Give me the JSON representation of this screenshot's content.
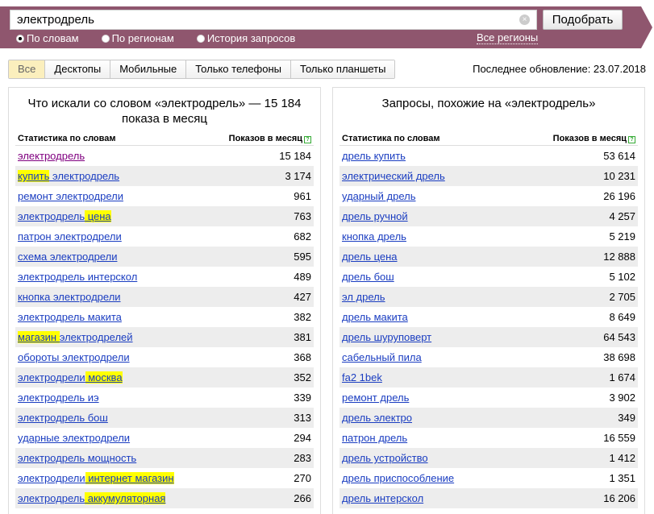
{
  "search": {
    "value": "электродрель",
    "button": "Подобрать",
    "modes": [
      "По словам",
      "По регионам",
      "История запросов"
    ],
    "regions": "Все регионы"
  },
  "tabs": [
    "Все",
    "Десктопы",
    "Мобильные",
    "Только телефоны",
    "Только планшеты"
  ],
  "last_update": "Последнее обновление: 23.07.2018",
  "left": {
    "title": "Что искали со словом «электродрель» — 15 184 показа в месяц",
    "col1": "Статистика по словам",
    "col2": "Показов в месяц",
    "rows": [
      {
        "parts": [
          {
            "t": "электродрель"
          }
        ],
        "count": "15 184",
        "visited": true
      },
      {
        "parts": [
          {
            "t": "купить",
            "h": true
          },
          {
            "t": " электродрель"
          }
        ],
        "count": "3 174"
      },
      {
        "parts": [
          {
            "t": "ремонт электродрели"
          }
        ],
        "count": "961"
      },
      {
        "parts": [
          {
            "t": "электродрель"
          },
          {
            "t": " цена",
            "h": true
          }
        ],
        "count": "763"
      },
      {
        "parts": [
          {
            "t": "патрон электродрели"
          }
        ],
        "count": "682"
      },
      {
        "parts": [
          {
            "t": "схема электродрели"
          }
        ],
        "count": "595"
      },
      {
        "parts": [
          {
            "t": "электродрель интерскол"
          }
        ],
        "count": "489"
      },
      {
        "parts": [
          {
            "t": "кнопка электродрели"
          }
        ],
        "count": "427"
      },
      {
        "parts": [
          {
            "t": "электродрель макита"
          }
        ],
        "count": "382"
      },
      {
        "parts": [
          {
            "t": "магазин ",
            "h": true
          },
          {
            "t": "электродрелей"
          }
        ],
        "count": "381"
      },
      {
        "parts": [
          {
            "t": "обороты электродрели"
          }
        ],
        "count": "368"
      },
      {
        "parts": [
          {
            "t": "электродрели"
          },
          {
            "t": " москва",
            "h": true
          }
        ],
        "count": "352"
      },
      {
        "parts": [
          {
            "t": "электродрель иэ"
          }
        ],
        "count": "339"
      },
      {
        "parts": [
          {
            "t": "электродрель бош"
          }
        ],
        "count": "313"
      },
      {
        "parts": [
          {
            "t": "ударные электродрели"
          }
        ],
        "count": "294"
      },
      {
        "parts": [
          {
            "t": "электродрель мощность"
          }
        ],
        "count": "283"
      },
      {
        "parts": [
          {
            "t": "электродрели"
          },
          {
            "t": " интернет магазин",
            "h": true
          }
        ],
        "count": "270"
      },
      {
        "parts": [
          {
            "t": "электродрель"
          },
          {
            "t": " аккумуляторная",
            "h": true
          }
        ],
        "count": "266"
      }
    ]
  },
  "right": {
    "title": "Запросы, похожие на «электродрель»",
    "col1": "Статистика по словам",
    "col2": "Показов в месяц",
    "rows": [
      {
        "parts": [
          {
            "t": "дрель купить"
          }
        ],
        "count": "53 614"
      },
      {
        "parts": [
          {
            "t": "электрический дрель"
          }
        ],
        "count": "10 231"
      },
      {
        "parts": [
          {
            "t": "ударный дрель"
          }
        ],
        "count": "26 196"
      },
      {
        "parts": [
          {
            "t": "дрель ручной"
          }
        ],
        "count": "4 257"
      },
      {
        "parts": [
          {
            "t": "кнопка дрель"
          }
        ],
        "count": "5 219"
      },
      {
        "parts": [
          {
            "t": "дрель цена"
          }
        ],
        "count": "12 888"
      },
      {
        "parts": [
          {
            "t": "дрель бош"
          }
        ],
        "count": "5 102"
      },
      {
        "parts": [
          {
            "t": "эл дрель"
          }
        ],
        "count": "2 705"
      },
      {
        "parts": [
          {
            "t": "дрель макита"
          }
        ],
        "count": "8 649"
      },
      {
        "parts": [
          {
            "t": "дрель шуруповерт"
          }
        ],
        "count": "64 543"
      },
      {
        "parts": [
          {
            "t": "сабельный пила"
          }
        ],
        "count": "38 698"
      },
      {
        "parts": [
          {
            "t": "fa2 1bek"
          }
        ],
        "count": "1 674"
      },
      {
        "parts": [
          {
            "t": "ремонт дрель"
          }
        ],
        "count": "3 902"
      },
      {
        "parts": [
          {
            "t": "дрель электро"
          }
        ],
        "count": "349"
      },
      {
        "parts": [
          {
            "t": "патрон дрель"
          }
        ],
        "count": "16 559"
      },
      {
        "parts": [
          {
            "t": "дрель устройство"
          }
        ],
        "count": "1 412"
      },
      {
        "parts": [
          {
            "t": "дрель приспособление"
          }
        ],
        "count": "1 351"
      },
      {
        "parts": [
          {
            "t": "дрель интерскол"
          }
        ],
        "count": "16 206"
      }
    ]
  }
}
